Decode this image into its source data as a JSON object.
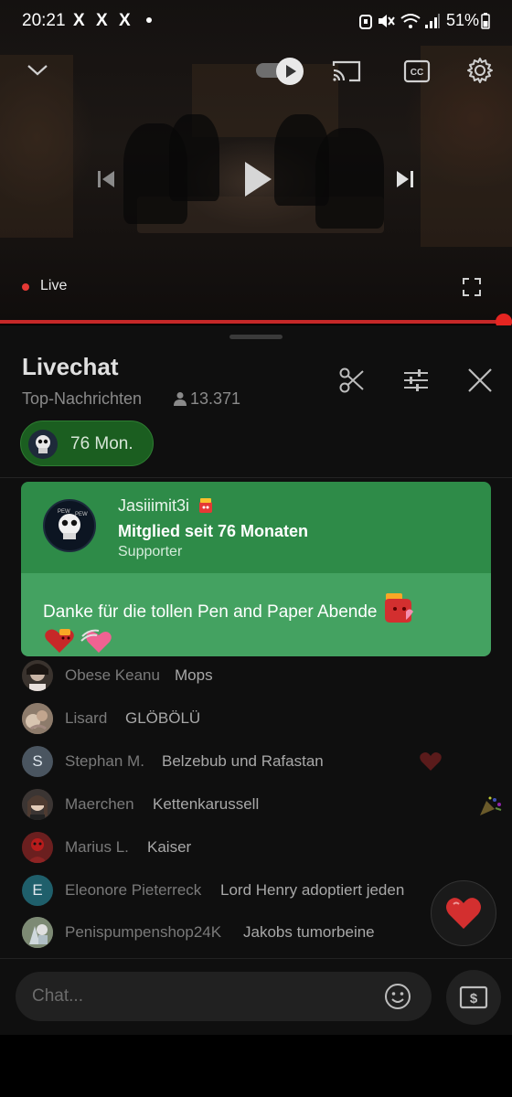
{
  "status_bar": {
    "time": "20:21",
    "notification_icons": [
      "X",
      "X",
      "X"
    ],
    "battery": "51%"
  },
  "player": {
    "live_label": "Live",
    "progress_fraction": 1.0,
    "accent_color": "#e52521"
  },
  "chat_panel": {
    "title": "Livechat",
    "filter_label": "Top-Nachrichten",
    "viewer_count": "13.371",
    "member_chip_label": "76 Mon.",
    "milestone_card": {
      "username": "Jasiiimit3i",
      "headline": "Mitglied seit 76 Monaten",
      "tier": "Supporter",
      "message": "Danke für die tollen Pen and Paper Abende",
      "header_color": "#2e8b48",
      "body_color": "#44a261"
    },
    "messages": [
      {
        "author": "Obese Keanu",
        "text": "Mops",
        "avatar": "photo"
      },
      {
        "author": "Lisard",
        "text": "GLÖBÖLÜ",
        "avatar": "photo"
      },
      {
        "author": "Stephan M.",
        "text": "Belzebub und Rafastan",
        "avatar_letter": "S",
        "avatar_color": "#4a5560"
      },
      {
        "author": "Maerchen",
        "text": "Kettenkarussell",
        "avatar": "photo"
      },
      {
        "author": "Marius L.",
        "text": "Kaiser",
        "avatar": "photo"
      },
      {
        "author": "Eleonore Pieterreck",
        "text": "Lord Henry adoptiert jeden",
        "avatar_letter": "E",
        "avatar_color": "#1f5f6b"
      },
      {
        "author": "Penispumpenshop24K",
        "text": "Jakobs tumorbeine",
        "avatar": "photo"
      }
    ]
  },
  "composer": {
    "placeholder": "Chat..."
  }
}
